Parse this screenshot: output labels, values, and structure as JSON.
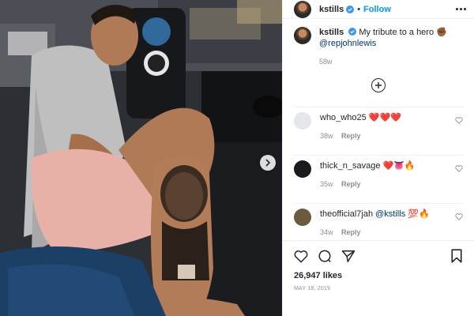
{
  "header": {
    "username": "kstills",
    "separator": "•",
    "follow_label": "Follow"
  },
  "caption": {
    "username": "kstills",
    "text": "My tribute to a hero",
    "emoji": "✊🏾",
    "mention": "@repjohnlewis",
    "age": "58w"
  },
  "comments": [
    {
      "username": "who_who25",
      "text": "❤️❤️❤️",
      "age": "38w",
      "reply_label": "Reply",
      "avatar_color": "#e4e6eb"
    },
    {
      "username": "thick_n_savage",
      "text": "❤️👅🔥",
      "age": "35w",
      "reply_label": "Reply",
      "avatar_color": "#1b1b1b"
    },
    {
      "username": "theofficial7jah",
      "mention": "@kstills",
      "text": "💯🔥",
      "age": "34w",
      "reply_label": "Reply",
      "avatar_color": "#6b5a3d"
    }
  ],
  "likes": "26,947 likes",
  "date": "MAY 18, 2019",
  "colors": {
    "link": "#0095f6",
    "mention": "#00376b",
    "muted": "#8e8e8e",
    "verified": "#3897f0"
  }
}
